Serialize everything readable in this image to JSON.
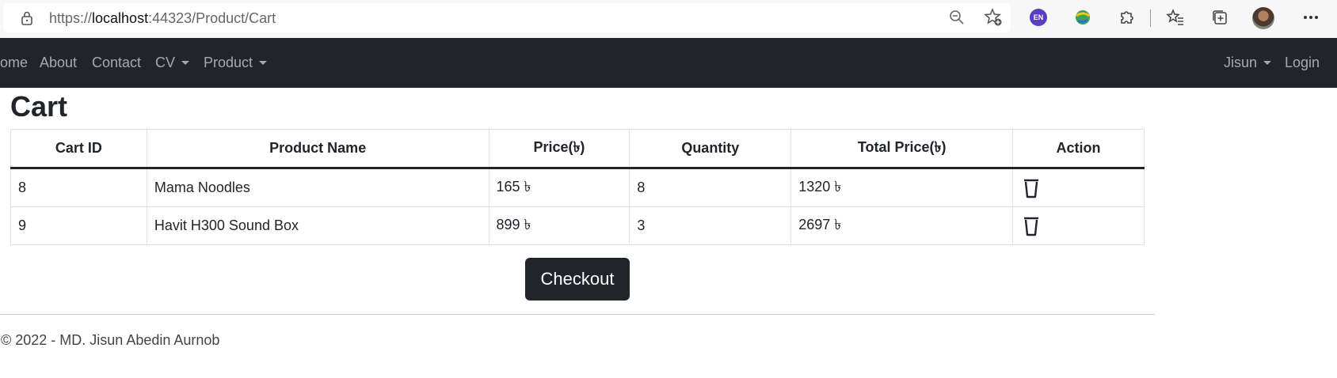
{
  "browser": {
    "url_prefix": "https://",
    "url_host": "localhost",
    "url_path": ":44323/Product/Cart",
    "profile_badge": "EN"
  },
  "nav": {
    "home": "ome",
    "about": "About",
    "contact": "Contact",
    "cv": "CV",
    "product": "Product",
    "user": "Jisun",
    "login": "Login"
  },
  "page": {
    "title": "Cart",
    "checkout_label": "Checkout",
    "footer": "© 2022 - MD. Jisun Abedin Aurnob"
  },
  "table": {
    "headers": [
      "Cart ID",
      "Product Name",
      "Price(৳)",
      "Quantity",
      "Total Price(৳)",
      "Action"
    ],
    "rows": [
      {
        "id": "8",
        "name": "Mama Noodles",
        "price": "165 ৳",
        "qty": "8",
        "total": "1320 ৳"
      },
      {
        "id": "9",
        "name": "Havit H300 Sound Box",
        "price": "899 ৳",
        "qty": "3",
        "total": "2697 ৳"
      }
    ]
  },
  "colors": {
    "navbar": "#212529",
    "button": "#212529",
    "text": "#212529"
  }
}
